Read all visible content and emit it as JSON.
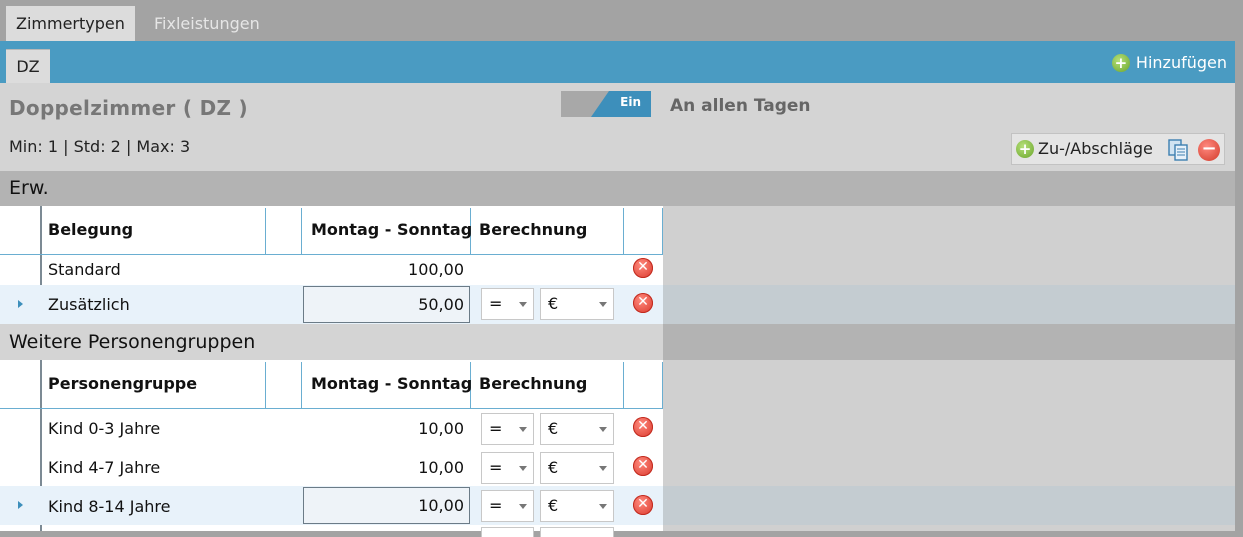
{
  "tabs": [
    {
      "label": "Zimmertypen",
      "active": true
    },
    {
      "label": "Fixleistungen",
      "active": false
    }
  ],
  "room_tab": {
    "label": "DZ"
  },
  "add_label": "Hinzufügen",
  "room": {
    "title": "Doppelzimmer  ( DZ )",
    "minmax": "Min:  1  |  Std:  2  |  Max:  3"
  },
  "toggle": {
    "label": "Ein",
    "state": "on"
  },
  "days_label": "An allen Tagen",
  "zu_label": "Zu-/Abschläge",
  "section_erw": {
    "title": "Erw.",
    "headers": [
      "Belegung",
      "",
      "Montag - Sonntag",
      "Berechnung"
    ],
    "rows": [
      {
        "label": "Standard",
        "value": "100,00"
      },
      {
        "label": "Zusätzlich",
        "value": "50,00",
        "op": "=",
        "unit": "€",
        "selected": true
      }
    ]
  },
  "section_weitere": {
    "title": "Weitere Personengruppen",
    "headers": [
      "Personengruppe",
      "",
      "Montag - Sonntag",
      "Berechnung"
    ],
    "rows": [
      {
        "label": "Kind 0-3 Jahre",
        "value": "10,00",
        "op": "=",
        "unit": "€"
      },
      {
        "label": "Kind 4-7 Jahre",
        "value": "10,00",
        "op": "=",
        "unit": "€"
      },
      {
        "label": "Kind 8-14 Jahre",
        "value": "10,00",
        "op": "=",
        "unit": "€",
        "selected": true
      }
    ]
  },
  "colors": {
    "accent": "#4a9bc2",
    "panel": "#d4d4d4",
    "delete": "#d9362a",
    "add": "#6aa52b"
  }
}
